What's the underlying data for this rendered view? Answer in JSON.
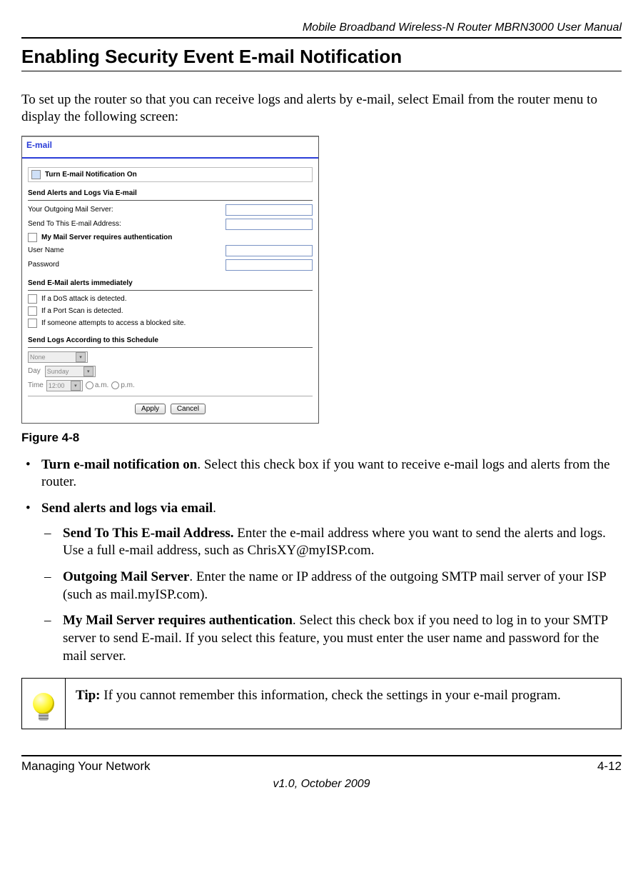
{
  "header": {
    "manual_title": "Mobile Broadband Wireless-N Router MBRN3000 User Manual"
  },
  "heading": "Enabling Security Event E-mail Notification",
  "intro": "To set up the router so that you can receive logs and alerts by e-mail, select Email from the router menu to display the following screen:",
  "screenshot": {
    "title": "E-mail",
    "notify_checkbox_label": "Turn E-mail Notification On",
    "section1_label": "Send Alerts and Logs Via E-mail",
    "outgoing_label": "Your Outgoing Mail Server:",
    "sendto_label": "Send To This E-mail Address:",
    "auth_checkbox_label": "My Mail Server requires authentication",
    "username_label": "User Name",
    "password_label": "Password",
    "section2_label": "Send E-Mail alerts immediately",
    "alert_dos": "If a DoS attack is detected.",
    "alert_portscan": "If a Port Scan is detected.",
    "alert_blocked": "If someone attempts to access a blocked site.",
    "section3_label": "Send Logs According to this Schedule",
    "schedule_none": "None",
    "day_label": "Day",
    "day_value": "Sunday",
    "time_label": "Time",
    "time_value": "12:00",
    "am": "a.m.",
    "pm": "p.m.",
    "apply": "Apply",
    "cancel": "Cancel"
  },
  "figure_caption": "Figure 4-8",
  "bullets": {
    "b1_bold": "Turn e-mail notification on",
    "b1_rest": ". Select this check box if you want to receive e-mail logs and alerts from the router.",
    "b2_bold": "Send alerts and logs via email",
    "b2_rest": ".",
    "s1_bold": "Send To This E-mail Address.",
    "s1_rest": " Enter the e-mail address where you want to send the alerts and logs. Use a full e-mail address, such as ChrisXY@myISP.com.",
    "s2_bold": "Outgoing Mail Server",
    "s2_rest": ". Enter the name or IP address of the outgoing SMTP mail server of your ISP (such as mail.myISP.com).",
    "s3_bold": "My Mail Server requires authentication",
    "s3_rest": ". Select this check box if you need to log in to your SMTP server to send E-mail. If you select this feature, you must enter the user name and password for the mail server."
  },
  "tip": {
    "label": "Tip:",
    "text": " If you cannot remember this information, check the settings in your e-mail program."
  },
  "footer": {
    "section": "Managing Your Network",
    "page": "4-12",
    "version": "v1.0, October 2009"
  }
}
